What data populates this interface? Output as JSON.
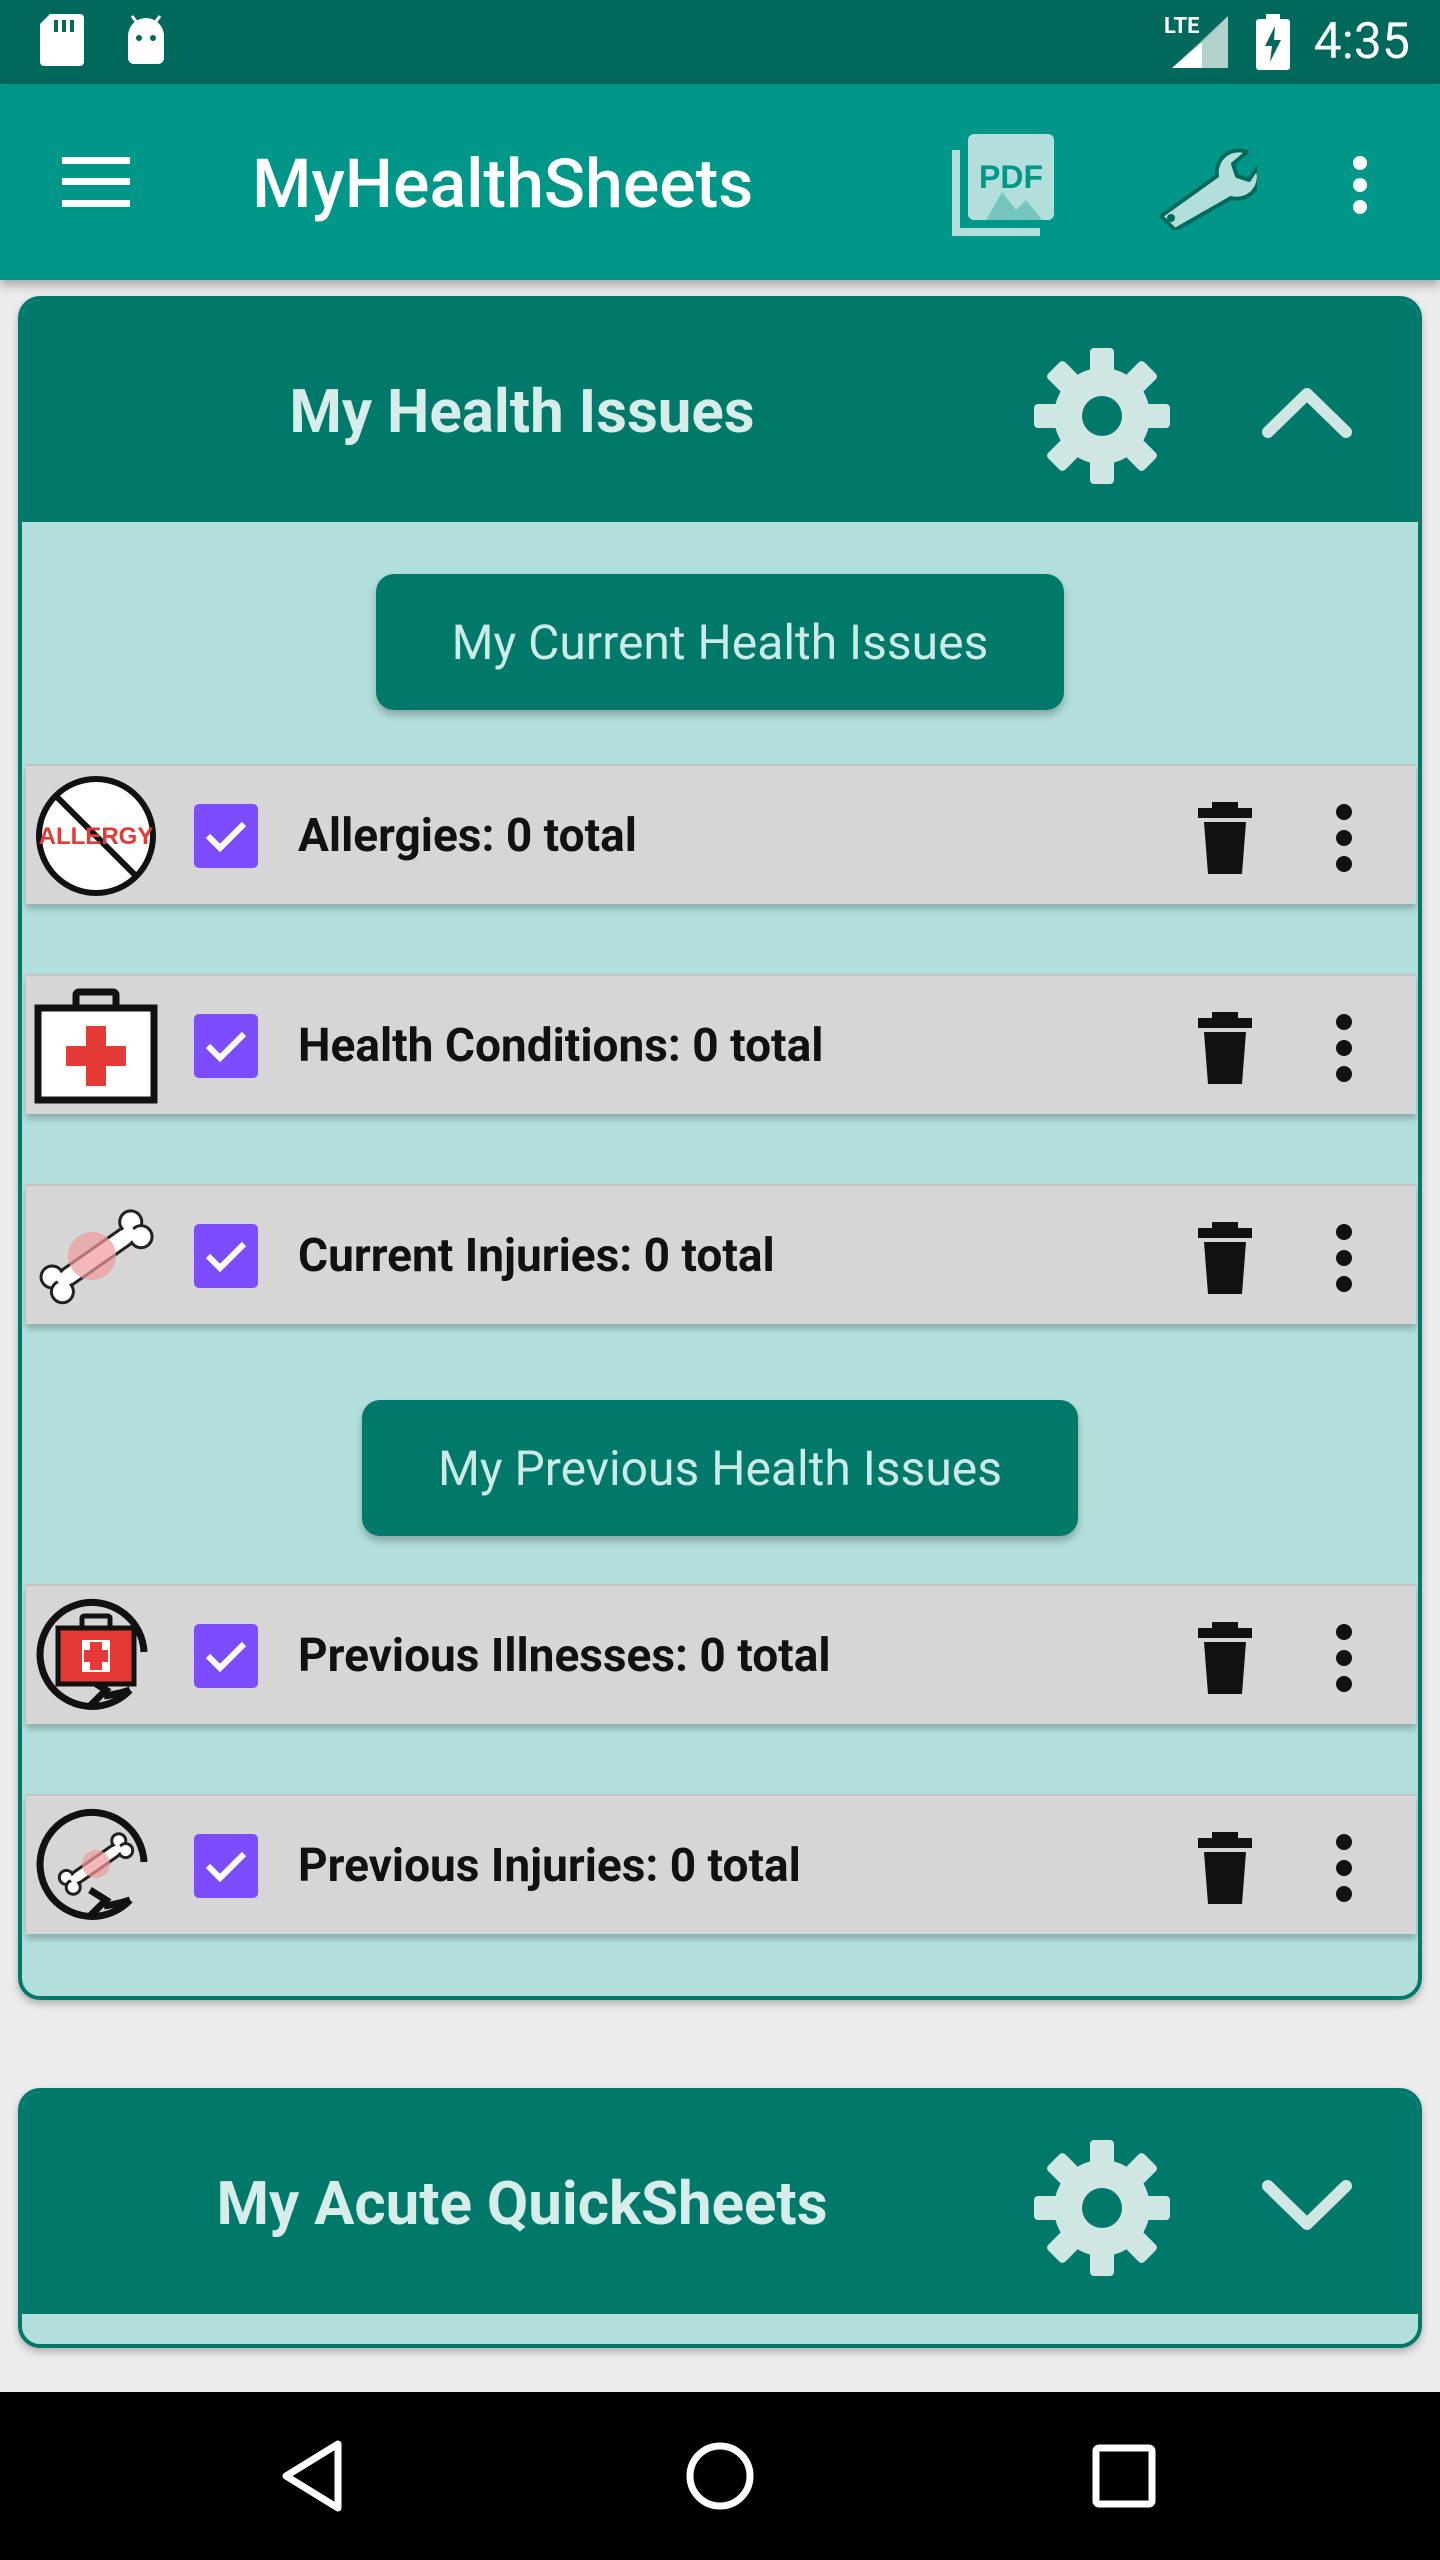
{
  "status_bar": {
    "time": "4:35",
    "network": "LTE",
    "icons": [
      "sd-card-icon",
      "android-icon",
      "signal-icon",
      "battery-charging-icon"
    ]
  },
  "app_bar": {
    "title": "MyHealthSheets",
    "icons": [
      "menu-icon",
      "pdf-icon",
      "wrench-icon",
      "overflow-icon"
    ]
  },
  "health_issues": {
    "title": "My Health Issues",
    "current_button": "My Current Health Issues",
    "previous_button": "My Previous Health Issues",
    "current_items": [
      {
        "label": "Allergies: 0 total",
        "icon": "allergy-icon",
        "checked": true
      },
      {
        "label": "Health Conditions: 0 total",
        "icon": "first-aid-kit-icon",
        "checked": true
      },
      {
        "label": "Current Injuries: 0 total",
        "icon": "broken-bone-icon",
        "checked": true
      }
    ],
    "previous_items": [
      {
        "label": "Previous Illnesses: 0 total",
        "icon": "previous-illness-icon",
        "checked": true
      },
      {
        "label": "Previous Injuries: 0 total",
        "icon": "previous-injury-icon",
        "checked": true
      }
    ],
    "allergy_icon_text": "ALLERGY"
  },
  "acute_quicksheets": {
    "title": "My Acute QuickSheets"
  },
  "nav_bar": {
    "icons": [
      "back-icon",
      "home-icon",
      "recents-icon"
    ]
  }
}
